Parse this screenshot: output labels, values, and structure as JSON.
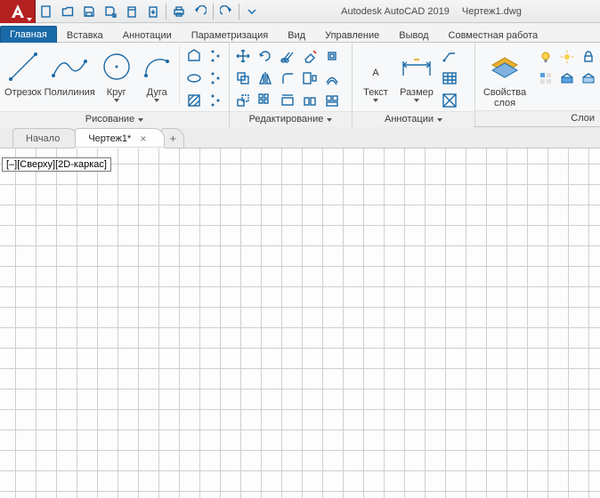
{
  "title": {
    "app": "Autodesk AutoCAD 2019",
    "file": "Чертеж1.dwg"
  },
  "tabs": [
    "Главная",
    "Вставка",
    "Аннотации",
    "Параметризация",
    "Вид",
    "Управление",
    "Вывод",
    "Совместная работа"
  ],
  "active_tab_index": 0,
  "panels": {
    "draw": {
      "title": "Рисование",
      "big": [
        {
          "label": "Отрезок"
        },
        {
          "label": "Полилиния"
        },
        {
          "label": "Круг"
        },
        {
          "label": "Дуга"
        }
      ]
    },
    "modify": {
      "title": "Редактирование"
    },
    "annot": {
      "title": "Аннотации",
      "big": [
        {
          "label": "Текст"
        },
        {
          "label": "Размер"
        }
      ]
    },
    "layers": {
      "title": "Слои",
      "big": [
        {
          "label": "Свойства\nслоя"
        }
      ]
    }
  },
  "file_tabs": [
    {
      "label": "Начало",
      "active": false,
      "closable": false
    },
    {
      "label": "Чертеж1*",
      "active": true,
      "closable": true
    }
  ],
  "viewport_label": "[–][Сверху][2D-каркас]",
  "colors": {
    "accent": "#1a6aa8",
    "brand": "#b42121"
  }
}
